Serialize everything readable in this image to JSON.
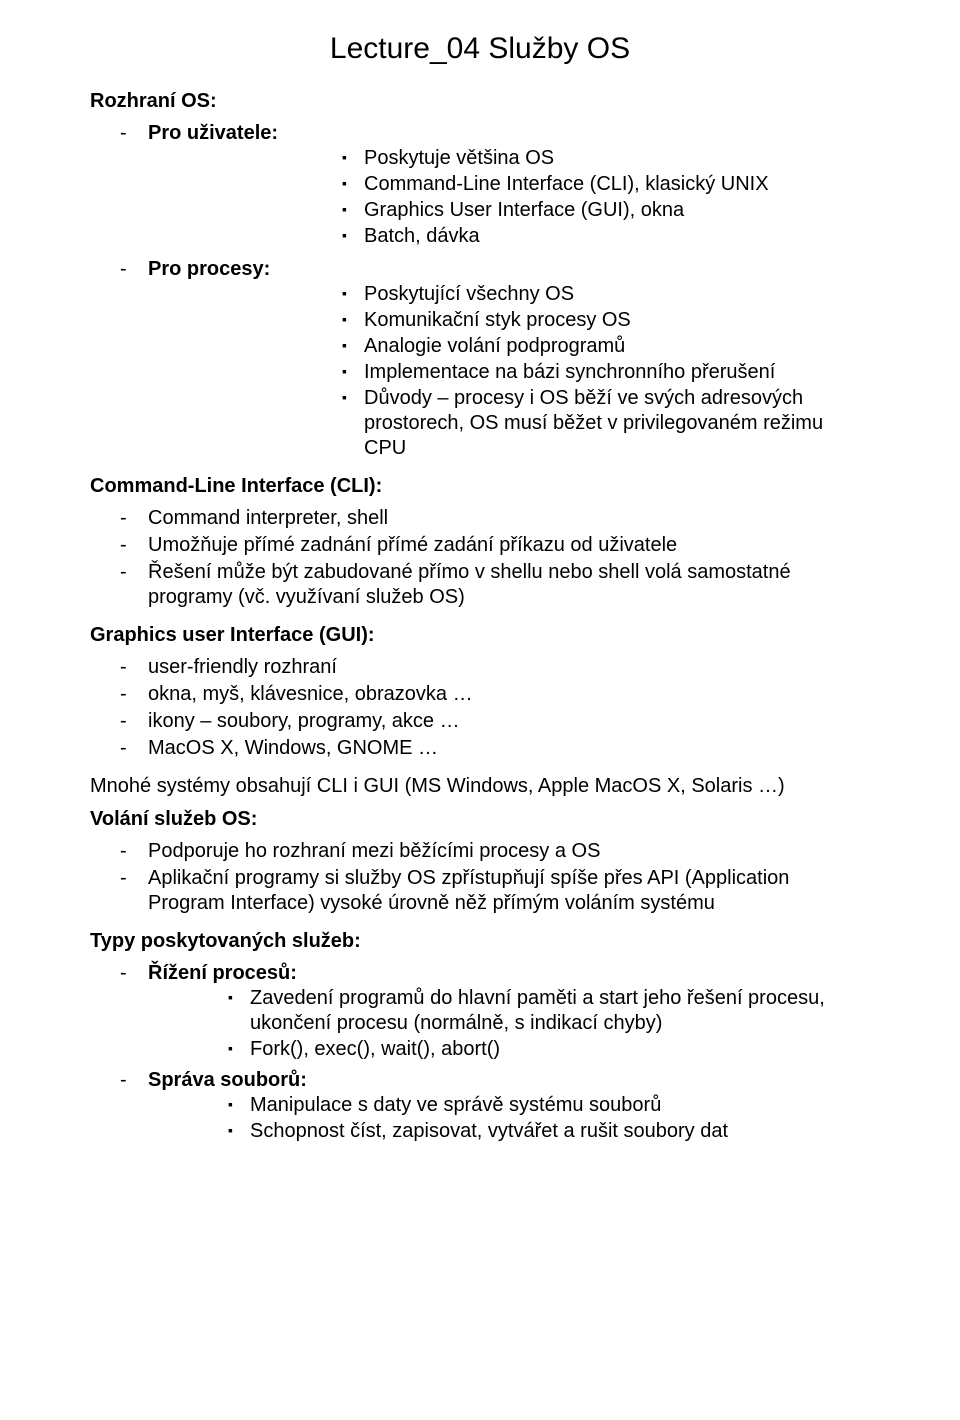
{
  "title": "Lecture_04 Služby OS",
  "s1": {
    "heading": "Rozhraní OS:",
    "i1": {
      "label": "Pro uživatele:",
      "sub": [
        "Poskytuje většina OS",
        "Command-Line Interface (CLI), klasický UNIX",
        "Graphics User Interface (GUI), okna",
        "Batch, dávka"
      ]
    },
    "i2": {
      "label": "Pro procesy:",
      "sub": [
        "Poskytující všechny OS",
        "Komunikační styk procesy OS",
        "Analogie volání podprogramů",
        "Implementace na bázi synchronního přerušení",
        "Důvody – procesy i OS běží ve svých adresových prostorech, OS musí běžet v privilegovaném režimu CPU"
      ]
    }
  },
  "s2": {
    "heading": "Command-Line Interface (CLI):",
    "items": [
      "Command interpreter, shell",
      "Umožňuje přímé zadnání přímé zadání příkazu od uživatele",
      "Řešení může být zabudované přímo v shellu nebo shell volá samostatné programy (vč. využívaní služeb OS)"
    ]
  },
  "s3": {
    "heading": "Graphics user Interface (GUI):",
    "items": [
      "user-friendly rozhraní",
      "okna, myš, klávesnice, obrazovka …",
      "ikony – soubory, programy, akce …",
      "MacOS X, Windows, GNOME …"
    ]
  },
  "para1": "Mnohé systémy obsahují CLI i GUI (MS Windows, Apple MacOS X, Solaris …)",
  "s4": {
    "heading": "Volání služeb OS:",
    "items": [
      "Podporuje ho rozhraní mezi běžícími procesy a OS",
      "Aplikační programy si služby OS zpřístupňují spíše přes API (Application Program Interface) vysoké úrovně něž přímým voláním systému"
    ]
  },
  "s5": {
    "heading": "Typy poskytovaných služeb:",
    "i1": {
      "label": "Řížení procesů:",
      "sub": [
        "Zavedení programů do hlavní paměti a start jeho řešení procesu, ukončení procesu (normálně, s indikací chyby)",
        "Fork(), exec(), wait(), abort()"
      ]
    },
    "i2": {
      "label": "Správa souborů:",
      "sub": [
        "Manipulace s daty ve správě systému souborů",
        "Schopnost číst, zapisovat, vytvářet a rušit soubory dat"
      ]
    }
  }
}
